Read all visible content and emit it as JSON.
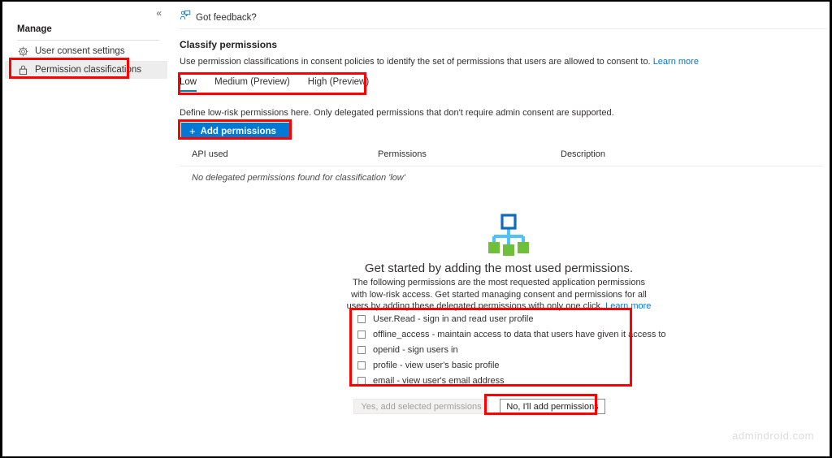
{
  "sidebar": {
    "collapse_icon": "double-chevron-left-icon",
    "section_label": "Manage",
    "items": [
      {
        "label": "User consent settings",
        "icon": "gear-icon",
        "selected": false
      },
      {
        "label": "Permission classifications",
        "icon": "lock-icon",
        "selected": true
      }
    ]
  },
  "main": {
    "feedback": {
      "label": "Got feedback?",
      "icon": "feedback-person-icon"
    },
    "title": "Classify permissions",
    "description": "Use permission classifications in consent policies to identify the set of permissions that users are allowed to consent to.",
    "description_link": "Learn more",
    "tabs": [
      {
        "label": "Low",
        "active": true
      },
      {
        "label": "Medium (Preview)",
        "active": false
      },
      {
        "label": "High (Preview)",
        "active": false
      }
    ],
    "define_text": "Define low-risk permissions here. Only delegated permissions that don't require admin consent are supported.",
    "add_permissions_button": "Add permissions",
    "add_permissions_icon": "plus-icon",
    "table": {
      "columns": [
        "API used",
        "Permissions",
        "Description"
      ],
      "empty_message": "No delegated permissions found for classification 'low'"
    },
    "empty_state": {
      "illustration_icon": "hierarchy-org-chart-icon",
      "heading": "Get started by adding the most used permissions.",
      "paragraph": "The following permissions are the most requested application permissions with low-risk access. Get started managing consent and permissions for all users by adding these delegated permissions with only one click.",
      "paragraph_link": "Learn more",
      "permissions": [
        {
          "label": "User.Read - sign in and read user profile",
          "checked": false
        },
        {
          "label": "offline_access - maintain access to data that users have given it access to",
          "checked": false
        },
        {
          "label": "openid - sign users in",
          "checked": false
        },
        {
          "label": "profile - view user's basic profile",
          "checked": false
        },
        {
          "label": "email - view user's email address",
          "checked": false
        }
      ],
      "confirm_button": "Yes, add selected permissions",
      "dismiss_button": "No, I'll add permissions"
    }
  },
  "watermark": "admindroid.com",
  "colors": {
    "accent": "#0078d4",
    "annotation": "#ff0000",
    "selected_nav_bg": "#ededed",
    "illustration_blue": "#0f6cbd",
    "illustration_cyan": "#4fc3f7",
    "illustration_green": "#6fbf3a"
  }
}
